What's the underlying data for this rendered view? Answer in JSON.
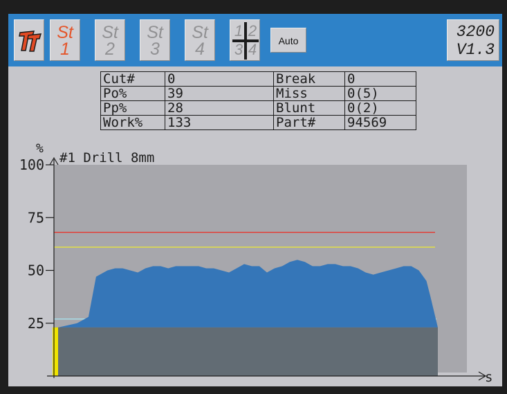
{
  "header": {
    "logo": "tt-logo-icon",
    "stations": [
      {
        "prefix": "St",
        "number": "1",
        "active": true
      },
      {
        "prefix": "St",
        "number": "2",
        "active": false
      },
      {
        "prefix": "St",
        "number": "3",
        "active": false
      },
      {
        "prefix": "St",
        "number": "4",
        "active": false
      }
    ],
    "quad_view": {
      "tl": "1",
      "tr": "2",
      "bl": "3",
      "br": "4"
    },
    "auto_label": "Auto",
    "model": "3200",
    "version": "V1.3"
  },
  "stats": {
    "rows": [
      {
        "label": "Cut#",
        "value": "0",
        "label2": "Break",
        "value2": "0"
      },
      {
        "label": "Po%",
        "value": "39",
        "label2": "Miss",
        "value2": "0(5)"
      },
      {
        "label": "Pp%",
        "value": "28",
        "label2": "Blunt",
        "value2": "0(2)"
      },
      {
        "label": "Work%",
        "value": "133",
        "label2": "Part#",
        "value2": "94569"
      }
    ]
  },
  "chart_data": {
    "type": "area",
    "title": "#1 Drill 8mm",
    "ylabel": "%",
    "xlabel": "s",
    "ylim": [
      0,
      100
    ],
    "yticks": [
      "100",
      "75",
      "50",
      "25"
    ],
    "thresholds": [
      {
        "value": 68,
        "color": "#e8342a"
      },
      {
        "value": 61,
        "color": "#e8e63c"
      },
      {
        "value": 27,
        "color": "#a8e2ec"
      }
    ],
    "baseline": 23,
    "series": [
      {
        "color": "#3576b8",
        "x": [
          0,
          5,
          8,
          10,
          13,
          15,
          17,
          19,
          21,
          23,
          25,
          27,
          29,
          31,
          33,
          35,
          37,
          39,
          41,
          43,
          45,
          47,
          49,
          51,
          53,
          55,
          57,
          59,
          61,
          63,
          65,
          67,
          69,
          71,
          73,
          75,
          77,
          79,
          81,
          83,
          85,
          87,
          89,
          91,
          93,
          95,
          97,
          98,
          100
        ],
        "values": [
          23,
          25,
          28,
          47,
          50,
          51,
          51,
          50,
          49,
          51,
          52,
          52,
          51,
          52,
          52,
          52,
          52,
          51,
          51,
          50,
          49,
          51,
          53,
          52,
          52,
          49,
          51,
          52,
          54,
          55,
          54,
          52,
          52,
          53,
          53,
          52,
          52,
          51,
          49,
          48,
          49,
          50,
          51,
          52,
          52,
          50,
          45,
          38,
          23
        ]
      }
    ],
    "indicators": {
      "level_bar_color": "#f0e400",
      "base_color": "#626c74"
    }
  }
}
